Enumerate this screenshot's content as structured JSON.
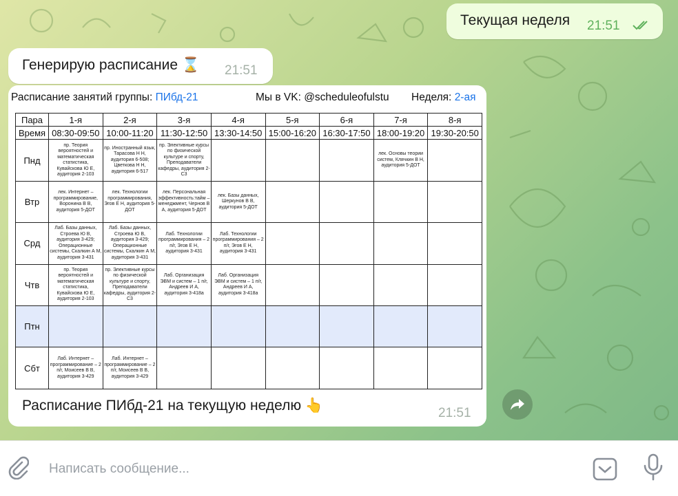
{
  "messages": {
    "outgoing_text": "Текущая неделя",
    "outgoing_time": "21:51",
    "generating_text": "Генерирую расписание ⌛",
    "generating_time": "21:51",
    "caption_text": "Расписание ПИбд-21 на текущую неделю 👆",
    "caption_time": "21:51"
  },
  "schedule": {
    "title_prefix": "Расписание занятий группы:",
    "group": "ПИбд-21",
    "vk": "Мы в VK: @scheduleofulstu",
    "week_label": "Неделя:",
    "week_value": "2-ая",
    "head_para": "Пара",
    "head_time": "Время",
    "periods": [
      "1-я",
      "2-я",
      "3-я",
      "4-я",
      "5-я",
      "6-я",
      "7-я",
      "8-я"
    ],
    "times": [
      "08:30-09:50",
      "10:00-11:20",
      "11:30-12:50",
      "13:30-14:50",
      "15:00-16:20",
      "16:30-17:50",
      "18:00-19:20",
      "19:30-20:50"
    ],
    "days": [
      {
        "name": "Пнд",
        "cells": [
          "пр. Теория вероятностей и математическая статистика, Кувайскова Ю Е, аудитория 2-103",
          "пр. Иностранный язык, Тарасова Н Н, аудитория 6-508; Цветкова Н Н, аудитория 6-517",
          "пр. Элективные курсы по физической культуре и спорту, Преподаватели кафедры, аудитория 2-С3",
          "",
          "",
          "",
          "лек. Основы теории систем, Клячкин В Н, аудитория 5-ДОТ",
          ""
        ]
      },
      {
        "name": "Втр",
        "cells": [
          "лек. Интернет – программирование, Воронина В В, аудитория 5-ДОТ",
          "лек. Технологии программирования, Эгов Е Н, аудитория 5-ДОТ",
          "лек. Персональная эффективность:тайм – менеджмент, Чернов В А, аудитория 5-ДОТ",
          "лек. Базы данных, Шеркунов В В, аудитория 5-ДОТ",
          "",
          "",
          "",
          ""
        ]
      },
      {
        "name": "Срд",
        "cells": [
          "Лаб. Базы данных, Строева Ю В, аудитория 3-429; Операционные системы, Скалкин А М, аудитория 3-431",
          "Лаб. Базы данных, Строева Ю В, аудитория 3-429; Операционные системы, Скалкин А М, аудитория 3-431",
          "Лаб. Технологии программирования – 2 п/г, Эгов Е Н, аудитория 3-431",
          "Лаб. Технологии программирования – 2 п/г, Эгов Е Н, аудитория 3-431",
          "",
          "",
          "",
          ""
        ]
      },
      {
        "name": "Чтв",
        "cells": [
          "пр. Теория вероятностей и математическая статистика, Кувайскова Ю Е, аудитория 2-103",
          "пр. Элективные курсы по физической культуре и спорту, Преподаватели кафедры, аудитория 2-С3",
          "Лаб. Организация ЭВМ и систем – 1 п/г, Андреев И А, аудитория 3-418а",
          "Лаб. Организация ЭВМ и систем – 1 п/г, Андреев И А, аудитория 3-418а",
          "",
          "",
          "",
          ""
        ]
      },
      {
        "name": "Птн",
        "cells": [
          "",
          "",
          "",
          "",
          "",
          "",
          "",
          ""
        ]
      },
      {
        "name": "Сбт",
        "cells": [
          "Лаб. Интернет – программирование – 2 п/г, Моисеев В В, аудитория 3-429",
          "Лаб. Интернет – программирование – 2 п/г, Моисеев В В, аудитория 3-429",
          "",
          "",
          "",
          "",
          "",
          ""
        ]
      }
    ]
  },
  "composer": {
    "placeholder": "Написать сообщение..."
  },
  "icons": {
    "attach": "paperclip-icon",
    "forward": "forward-arrow-icon",
    "sticker": "sticker-icon",
    "mic": "microphone-icon",
    "read": "double-check-icon"
  },
  "colors": {
    "accent_blue": "#1a73e8",
    "time_green": "#5fb15c",
    "highlight_row": "#e2eafb"
  }
}
